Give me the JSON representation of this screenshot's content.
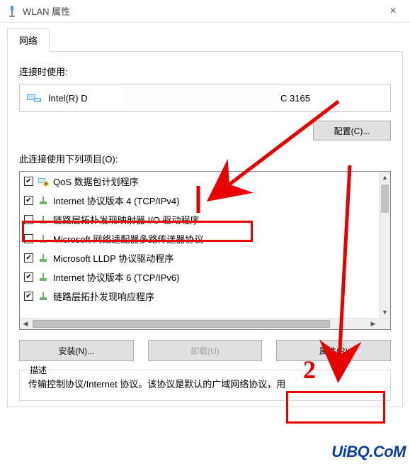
{
  "window": {
    "title": "WLAN 属性",
    "close_glyph": "×"
  },
  "tab": {
    "network": "网络"
  },
  "adapter": {
    "label": "连接时使用:",
    "name_prefix": "Intel(R) D",
    "name_suffix": "C 3165",
    "configure_btn": "配置(C)..."
  },
  "items_label": "此连接使用下列项目(O):",
  "items": [
    {
      "checked": true,
      "icon": "qos",
      "label": "QoS 数据包计划程序"
    },
    {
      "checked": true,
      "icon": "proto",
      "label": "Internet 协议版本 4 (TCP/IPv4)"
    },
    {
      "checked": false,
      "icon": "proto",
      "label": "链路层拓扑发现映射器 I/O 驱动程序"
    },
    {
      "checked": false,
      "icon": "proto",
      "label": "Microsoft 网络适配器多路传送器协议"
    },
    {
      "checked": true,
      "icon": "proto",
      "label": "Microsoft LLDP 协议驱动程序"
    },
    {
      "checked": true,
      "icon": "proto",
      "label": "Internet 协议版本 6 (TCP/IPv6)"
    },
    {
      "checked": true,
      "icon": "proto",
      "label": "链路层拓扑发现响应程序"
    }
  ],
  "buttons": {
    "install": "安装(N)...",
    "uninstall": "卸载(U)",
    "properties": "属性(R)"
  },
  "description": {
    "legend": "描述",
    "text": "传输控制协议/Internet 协议。该协议是默认的广域网络协议，用"
  },
  "annotations": {
    "number": "2"
  },
  "watermark": "UiBQ.CoM"
}
